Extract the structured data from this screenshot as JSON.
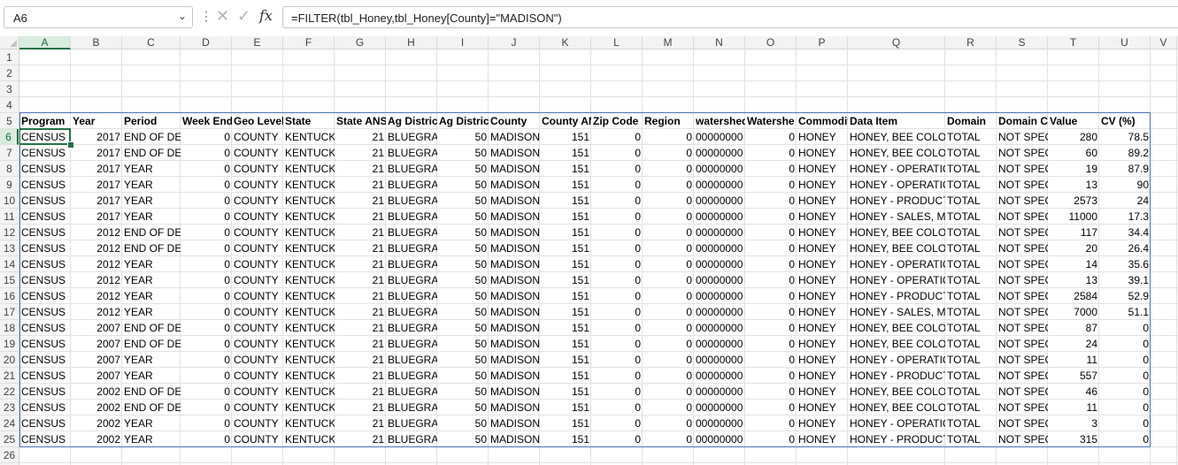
{
  "formula_bar": {
    "name_box": "A6",
    "formula": "=FILTER(tbl_Honey,tbl_Honey[County]=\"MADISON\")",
    "icons": [
      "chevron-down-icon",
      "more-vertical-icon",
      "cancel-icon",
      "enter-icon",
      "fx-icon"
    ]
  },
  "columns": [
    "A",
    "B",
    "C",
    "D",
    "E",
    "F",
    "G",
    "H",
    "I",
    "J",
    "K",
    "L",
    "M",
    "N",
    "O",
    "P",
    "Q",
    "R",
    "S",
    "T",
    "U",
    "V"
  ],
  "selected_column": "A",
  "selected_row": 6,
  "rows": [
    "1",
    "2",
    "3",
    "4",
    "5",
    "6",
    "7",
    "8",
    "9",
    "10",
    "11",
    "12",
    "13",
    "14",
    "15",
    "16",
    "17",
    "18",
    "19",
    "20",
    "21",
    "22",
    "23",
    "24",
    "25",
    "26"
  ],
  "headers": [
    "Program",
    "Year",
    "Period",
    "Week End",
    "Geo Level",
    "State",
    "State ANS",
    "Ag District",
    "Ag District",
    "County",
    "County AN",
    "Zip Code",
    "Region",
    "watershed",
    "Watershe",
    "Commodit",
    "Data Item",
    "Domain",
    "Domain Ca",
    "Value",
    "CV (%)"
  ],
  "data": [
    [
      "CENSUS",
      "2017",
      "END OF DEC",
      "0",
      "COUNTY",
      "KENTUCKY",
      "21",
      "BLUEGRAS",
      "50",
      "MADISON",
      "151",
      "0",
      "0",
      "00000000",
      "0",
      "HONEY",
      "HONEY, BEE COLONI",
      "TOTAL",
      "NOT SPECI",
      "280",
      "78.5"
    ],
    [
      "CENSUS",
      "2017",
      "END OF DEC",
      "0",
      "COUNTY",
      "KENTUCKY",
      "21",
      "BLUEGRAS",
      "50",
      "MADISON",
      "151",
      "0",
      "0",
      "00000000",
      "0",
      "HONEY",
      "HONEY, BEE COLONI",
      "TOTAL",
      "NOT SPECI",
      "60",
      "89.2"
    ],
    [
      "CENSUS",
      "2017",
      "YEAR",
      "0",
      "COUNTY",
      "KENTUCKY",
      "21",
      "BLUEGRAS",
      "50",
      "MADISON",
      "151",
      "0",
      "0",
      "00000000",
      "0",
      "HONEY",
      "HONEY - OPERATION",
      "TOTAL",
      "NOT SPECI",
      "19",
      "87.9"
    ],
    [
      "CENSUS",
      "2017",
      "YEAR",
      "0",
      "COUNTY",
      "KENTUCKY",
      "21",
      "BLUEGRAS",
      "50",
      "MADISON",
      "151",
      "0",
      "0",
      "00000000",
      "0",
      "HONEY",
      "HONEY - OPERATION",
      "TOTAL",
      "NOT SPECI",
      "13",
      "90"
    ],
    [
      "CENSUS",
      "2017",
      "YEAR",
      "0",
      "COUNTY",
      "KENTUCKY",
      "21",
      "BLUEGRAS",
      "50",
      "MADISON",
      "151",
      "0",
      "0",
      "00000000",
      "0",
      "HONEY",
      "HONEY - PRODUCTIC",
      "TOTAL",
      "NOT SPECI",
      "2573",
      "24"
    ],
    [
      "CENSUS",
      "2017",
      "YEAR",
      "0",
      "COUNTY",
      "KENTUCKY",
      "21",
      "BLUEGRAS",
      "50",
      "MADISON",
      "151",
      "0",
      "0",
      "00000000",
      "0",
      "HONEY",
      "HONEY - SALES, MEA",
      "TOTAL",
      "NOT SPECI",
      "11000",
      "17.3"
    ],
    [
      "CENSUS",
      "2012",
      "END OF DEC",
      "0",
      "COUNTY",
      "KENTUCKY",
      "21",
      "BLUEGRAS",
      "50",
      "MADISON",
      "151",
      "0",
      "0",
      "00000000",
      "0",
      "HONEY",
      "HONEY, BEE COLONI",
      "TOTAL",
      "NOT SPECI",
      "117",
      "34.4"
    ],
    [
      "CENSUS",
      "2012",
      "END OF DEC",
      "0",
      "COUNTY",
      "KENTUCKY",
      "21",
      "BLUEGRAS",
      "50",
      "MADISON",
      "151",
      "0",
      "0",
      "00000000",
      "0",
      "HONEY",
      "HONEY, BEE COLONI",
      "TOTAL",
      "NOT SPECI",
      "20",
      "26.4"
    ],
    [
      "CENSUS",
      "2012",
      "YEAR",
      "0",
      "COUNTY",
      "KENTUCKY",
      "21",
      "BLUEGRAS",
      "50",
      "MADISON",
      "151",
      "0",
      "0",
      "00000000",
      "0",
      "HONEY",
      "HONEY - OPERATION",
      "TOTAL",
      "NOT SPECI",
      "14",
      "35.6"
    ],
    [
      "CENSUS",
      "2012",
      "YEAR",
      "0",
      "COUNTY",
      "KENTUCKY",
      "21",
      "BLUEGRAS",
      "50",
      "MADISON",
      "151",
      "0",
      "0",
      "00000000",
      "0",
      "HONEY",
      "HONEY - OPERATION",
      "TOTAL",
      "NOT SPECI",
      "13",
      "39.1"
    ],
    [
      "CENSUS",
      "2012",
      "YEAR",
      "0",
      "COUNTY",
      "KENTUCKY",
      "21",
      "BLUEGRAS",
      "50",
      "MADISON",
      "151",
      "0",
      "0",
      "00000000",
      "0",
      "HONEY",
      "HONEY - PRODUCTIC",
      "TOTAL",
      "NOT SPECI",
      "2584",
      "52.9"
    ],
    [
      "CENSUS",
      "2012",
      "YEAR",
      "0",
      "COUNTY",
      "KENTUCKY",
      "21",
      "BLUEGRAS",
      "50",
      "MADISON",
      "151",
      "0",
      "0",
      "00000000",
      "0",
      "HONEY",
      "HONEY - SALES, MEA",
      "TOTAL",
      "NOT SPECI",
      "7000",
      "51.1"
    ],
    [
      "CENSUS",
      "2007",
      "END OF DEC",
      "0",
      "COUNTY",
      "KENTUCKY",
      "21",
      "BLUEGRAS",
      "50",
      "MADISON",
      "151",
      "0",
      "0",
      "00000000",
      "0",
      "HONEY",
      "HONEY, BEE COLONI",
      "TOTAL",
      "NOT SPECI",
      "87",
      "0"
    ],
    [
      "CENSUS",
      "2007",
      "END OF DEC",
      "0",
      "COUNTY",
      "KENTUCKY",
      "21",
      "BLUEGRAS",
      "50",
      "MADISON",
      "151",
      "0",
      "0",
      "00000000",
      "0",
      "HONEY",
      "HONEY, BEE COLONI",
      "TOTAL",
      "NOT SPECI",
      "24",
      "0"
    ],
    [
      "CENSUS",
      "2007",
      "YEAR",
      "0",
      "COUNTY",
      "KENTUCKY",
      "21",
      "BLUEGRAS",
      "50",
      "MADISON",
      "151",
      "0",
      "0",
      "00000000",
      "0",
      "HONEY",
      "HONEY - OPERATION",
      "TOTAL",
      "NOT SPECI",
      "11",
      "0"
    ],
    [
      "CENSUS",
      "2007",
      "YEAR",
      "0",
      "COUNTY",
      "KENTUCKY",
      "21",
      "BLUEGRAS",
      "50",
      "MADISON",
      "151",
      "0",
      "0",
      "00000000",
      "0",
      "HONEY",
      "HONEY - PRODUCTIC",
      "TOTAL",
      "NOT SPECI",
      "557",
      "0"
    ],
    [
      "CENSUS",
      "2002",
      "END OF DEC",
      "0",
      "COUNTY",
      "KENTUCKY",
      "21",
      "BLUEGRAS",
      "50",
      "MADISON",
      "151",
      "0",
      "0",
      "00000000",
      "0",
      "HONEY",
      "HONEY, BEE COLONI",
      "TOTAL",
      "NOT SPECI",
      "46",
      "0"
    ],
    [
      "CENSUS",
      "2002",
      "END OF DEC",
      "0",
      "COUNTY",
      "KENTUCKY",
      "21",
      "BLUEGRAS",
      "50",
      "MADISON",
      "151",
      "0",
      "0",
      "00000000",
      "0",
      "HONEY",
      "HONEY, BEE COLONI",
      "TOTAL",
      "NOT SPECI",
      "11",
      "0"
    ],
    [
      "CENSUS",
      "2002",
      "YEAR",
      "0",
      "COUNTY",
      "KENTUCKY",
      "21",
      "BLUEGRAS",
      "50",
      "MADISON",
      "151",
      "0",
      "0",
      "00000000",
      "0",
      "HONEY",
      "HONEY - OPERATION",
      "TOTAL",
      "NOT SPECI",
      "3",
      "0"
    ],
    [
      "CENSUS",
      "2002",
      "YEAR",
      "0",
      "COUNTY",
      "KENTUCKY",
      "21",
      "BLUEGRAS",
      "50",
      "MADISON",
      "151",
      "0",
      "0",
      "00000000",
      "0",
      "HONEY",
      "HONEY - PRODUCTIC",
      "TOTAL",
      "NOT SPECI",
      "315",
      "0"
    ]
  ],
  "colors": {
    "selection_green": "#217346",
    "spill_border_blue": "#4a72b6",
    "header_bg": "#f3f3f3",
    "selected_header_bg": "#d8ecdf"
  }
}
